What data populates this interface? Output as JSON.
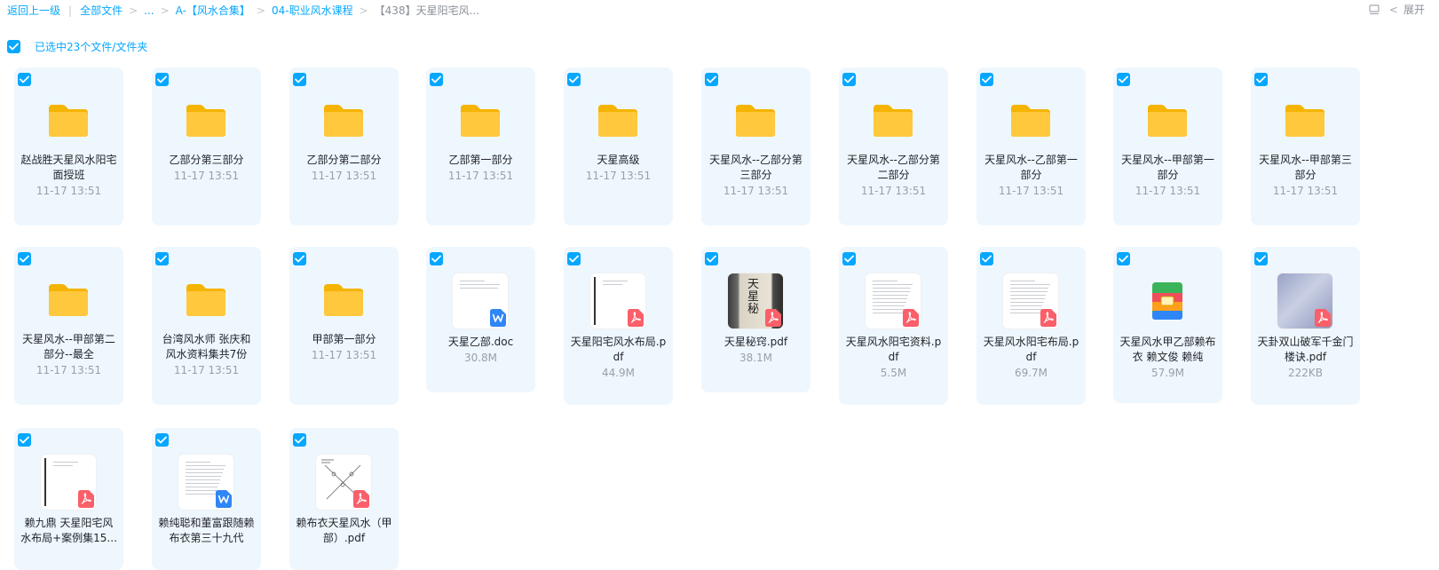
{
  "breadcrumb": {
    "back": "返回上一级",
    "all_files": "全部文件",
    "ellipsis": "...",
    "level1": "A-【风水合集】",
    "level2": "04-职业风水课程",
    "current": "【438】天星阳宅风..."
  },
  "toolbar": {
    "expand_label": "展开",
    "list_icon": "list-view-icon",
    "collapse_icon": "chevron-left-icon"
  },
  "selection": {
    "text": "已选中23个文件/文件夹"
  },
  "colors": {
    "accent": "#06a7ff",
    "card_bg": "#eef7fd",
    "folder": "#ffc83d",
    "pdf": "#fa5f6a",
    "word": "#2f86f6"
  },
  "files": [
    {
      "name": "赵战胜天星风水阳宅面授班",
      "meta": "11-17 13:51",
      "type": "folder"
    },
    {
      "name": "乙部分第三部分",
      "meta": "11-17 13:51",
      "type": "folder"
    },
    {
      "name": "乙部分第二部分",
      "meta": "11-17 13:51",
      "type": "folder"
    },
    {
      "name": "乙部第一部分",
      "meta": "11-17 13:51",
      "type": "folder"
    },
    {
      "name": "天星高级",
      "meta": "11-17 13:51",
      "type": "folder"
    },
    {
      "name": "天星风水--乙部分第三部分",
      "meta": "11-17 13:51",
      "type": "folder"
    },
    {
      "name": "天星风水--乙部分第二部分",
      "meta": "11-17 13:51",
      "type": "folder"
    },
    {
      "name": "天星风水--乙部第一部分",
      "meta": "11-17 13:51",
      "type": "folder"
    },
    {
      "name": "天星风水--甲部第一部分",
      "meta": "11-17 13:51",
      "type": "folder"
    },
    {
      "name": "天星风水--甲部第三部分",
      "meta": "11-17 13:51",
      "type": "folder"
    },
    {
      "name": "天星风水--甲部第二部分--最全",
      "meta": "11-17 13:51",
      "type": "folder"
    },
    {
      "name": "台湾风水师 张庆和风水资料集共7份",
      "meta": "11-17 13:51",
      "type": "folder"
    },
    {
      "name": "甲部第一部分",
      "meta": "11-17 13:51",
      "type": "folder"
    },
    {
      "name": "天星乙部.doc",
      "meta": "30.8M",
      "type": "doc"
    },
    {
      "name": "天星阳宅风水布局.pdf",
      "meta": "44.9M",
      "type": "pdf",
      "thumb": "text"
    },
    {
      "name": "天星秘窍.pdf",
      "meta": "38.1M",
      "type": "pdf",
      "thumb": "cover"
    },
    {
      "name": "天星风水阳宅资料.pdf",
      "meta": "5.5M",
      "type": "pdf",
      "thumb": "page"
    },
    {
      "name": "天星风水阳宅布局.pdf",
      "meta": "69.7M",
      "type": "pdf",
      "thumb": "page"
    },
    {
      "name": "天星风水甲乙部赖布衣 赖文俊 赖纯",
      "meta": "57.9M",
      "type": "zip"
    },
    {
      "name": "天卦双山破军千金门楼诀.pdf",
      "meta": "222KB",
      "type": "pdf",
      "thumb": "scan"
    },
    {
      "name": "赖九鼎 天星阳宅风水布局+案例集15...",
      "meta": "",
      "type": "pdf",
      "thumb": "text"
    },
    {
      "name": "赖纯聪和董富跟随赖布衣第三十九代",
      "meta": "",
      "type": "doc2"
    },
    {
      "name": "赖布衣天星风水（甲部）.pdf",
      "meta": "",
      "type": "pdf",
      "thumb": "diagram"
    }
  ]
}
